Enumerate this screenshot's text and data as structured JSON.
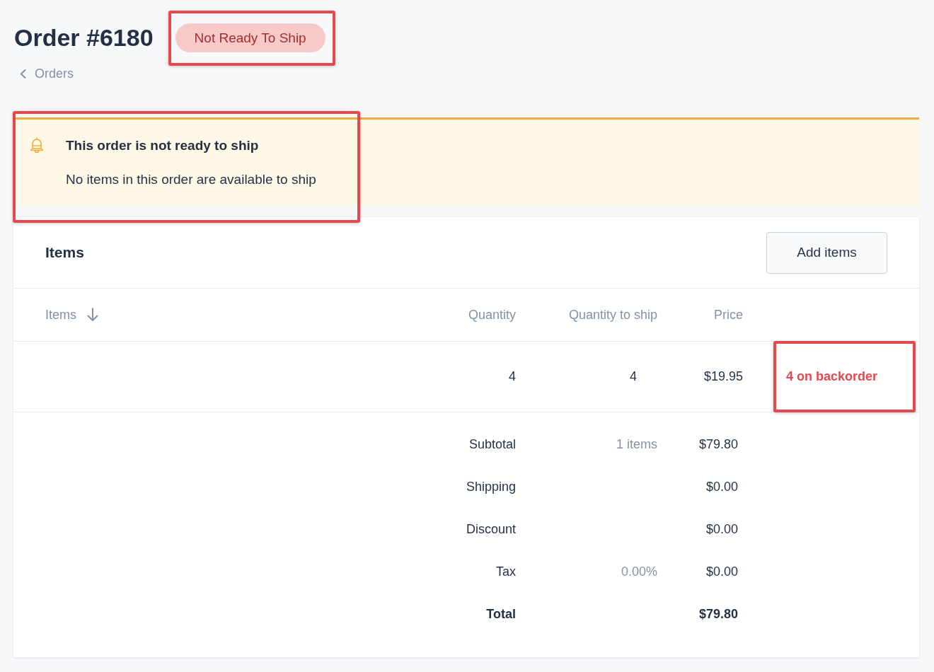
{
  "order": {
    "title": "Order #6180",
    "status": {
      "label": "Not Ready To Ship",
      "highlighted": true
    }
  },
  "back_link": {
    "label": "Orders"
  },
  "alert": {
    "title": "This order is not ready to ship",
    "message": "No items in this order are available to ship",
    "highlighted": true
  },
  "items_card": {
    "title": "Items",
    "add_button": "Add items",
    "columns": [
      {
        "label": "Items",
        "sorted": true
      },
      {
        "label": "Quantity",
        "sorted": false
      },
      {
        "label": "Quantity to ship",
        "sorted": false
      },
      {
        "label": "Price",
        "sorted": false
      }
    ],
    "rows": [
      {
        "quantity": "4",
        "quantity_to_ship": "4",
        "price": "$19.95",
        "stock_note": "4 on backorder",
        "highlighted": true
      }
    ],
    "totals": [
      {
        "kind": "line",
        "label": "Subtotal",
        "note": "1 items",
        "value": "$79.80"
      },
      {
        "kind": "line",
        "label": "Shipping",
        "value": "$0.00"
      },
      {
        "kind": "line",
        "label": "Discount",
        "value": "$0.00"
      },
      {
        "kind": "line",
        "label": "Tax",
        "note": "0.00%",
        "value": "$0.00"
      },
      {
        "kind": "total",
        "label": "Total",
        "value": "$79.80"
      }
    ]
  }
}
